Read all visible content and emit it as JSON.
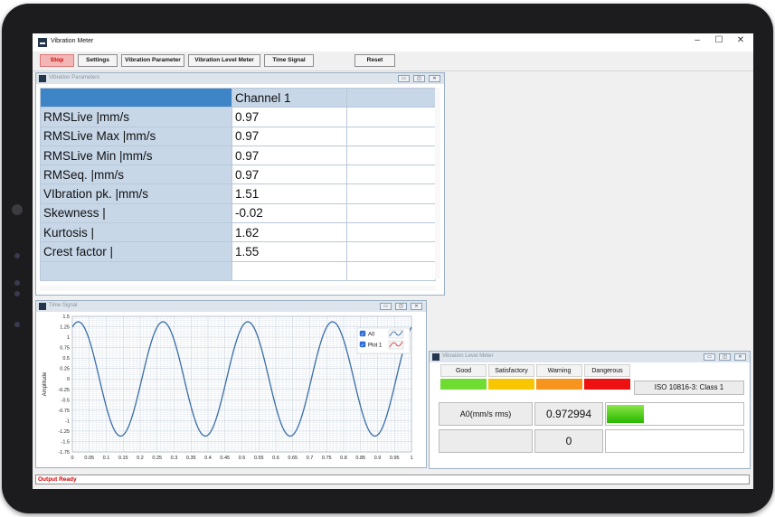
{
  "window": {
    "title": "Vibration Meter",
    "controls": [
      "–",
      "☐",
      "✕"
    ]
  },
  "toolbar": {
    "buttons": [
      "Stop",
      "Settings",
      "Vibration Parameter",
      "Vibration Level  Meter",
      "Time Signal",
      "Reset"
    ]
  },
  "params_frame": {
    "title": "Vibration Parameters",
    "channel_header": "Channel 1",
    "rows": [
      {
        "label": "RMSLive |mm/s",
        "value": "0.97"
      },
      {
        "label": "RMSLive Max |mm/s",
        "value": "0.97"
      },
      {
        "label": "RMSLive Min |mm/s",
        "value": "0.97"
      },
      {
        "label": "RMSeq. |mm/s",
        "value": "0.97"
      },
      {
        "label": "VIbration pk. |mm/s",
        "value": "1.51"
      },
      {
        "label": "Skewness |",
        "value": "-0.02"
      },
      {
        "label": "Kurtosis |",
        "value": "1.62"
      },
      {
        "label": "Crest factor |",
        "value": "1.55"
      }
    ]
  },
  "signal_frame": {
    "title": "Time Signal"
  },
  "chart_data": {
    "type": "line",
    "title": "",
    "xlabel": "",
    "ylabel": "Amplitude",
    "xlim": [
      0,
      1
    ],
    "ylim": [
      -1.75,
      1.5
    ],
    "x_ticks": [
      "0",
      "0.05",
      "0.1",
      "0.15",
      "0.2",
      "0.25",
      "0.3",
      "0.35",
      "0.4",
      "0.45",
      "0.5",
      "0.55",
      "0.6",
      "0.65",
      "0.7",
      "0.75",
      "0.8",
      "0.85",
      "0.9",
      "0.95",
      "1"
    ],
    "y_ticks": [
      "1.5",
      "1.25",
      "1",
      "0.75",
      "0.5",
      "0.25",
      "0",
      "-0.25",
      "-0.5",
      "-0.75",
      "-1",
      "-1.25",
      "-1.5",
      "-1.75"
    ],
    "grid": true,
    "legend_position": "top-right",
    "legend": [
      {
        "name": "A0",
        "checked": true,
        "color": "#3a6ea5"
      },
      {
        "name": "Plot 1",
        "checked": true,
        "color": "#d04040"
      }
    ],
    "series": [
      {
        "name": "A0",
        "color": "#3a6ea5",
        "amplitude": 1.37,
        "frequency_hz": 4,
        "phase_deg": 65,
        "x": [
          0,
          0.05,
          0.1,
          0.15,
          0.2,
          0.25,
          0.3,
          0.35,
          0.4,
          0.45,
          0.5,
          0.55,
          0.6,
          0.65,
          0.7,
          0.75,
          0.8,
          0.85,
          0.9,
          0.95,
          1
        ],
        "y": [
          1.24,
          0.76,
          -0.58,
          -1.37,
          -0.58,
          0.76,
          1.24,
          0.0,
          -1.24,
          -0.76,
          0.58,
          1.37,
          0.58,
          -0.76,
          -1.24,
          0.0,
          1.24,
          0.76,
          -0.58,
          -1.37,
          1.24
        ]
      }
    ]
  },
  "level_frame": {
    "title": "Vibration Level  Meter",
    "categories": [
      "Good",
      "Satisfactory",
      "Warning",
      "Dangerous"
    ],
    "category_colors": [
      "#6fdc32",
      "#f7c600",
      "#f7941d",
      "#ee1111"
    ],
    "standard": "ISO 10816-3: Class 1",
    "channel_label": "A0(mm/s rms)",
    "reading": "0.972994",
    "reading_fill": 0.27,
    "second_reading": "0"
  },
  "status": {
    "text": "Output Ready"
  }
}
